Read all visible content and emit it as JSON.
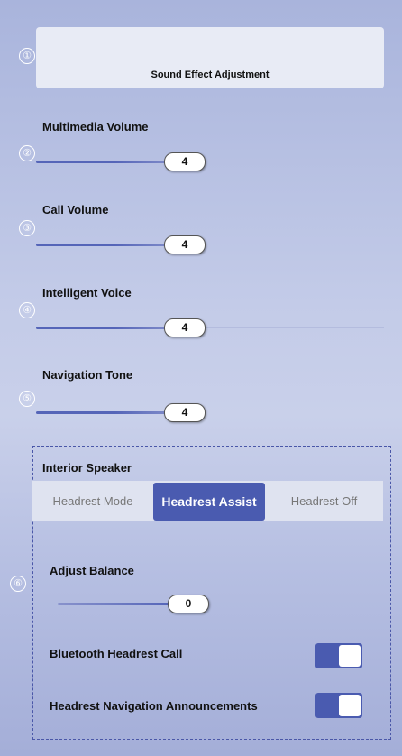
{
  "header": {
    "badge": "①",
    "title": "Sound Effect Adjustment"
  },
  "sliders": [
    {
      "badge": "②",
      "label": "Multimedia Volume",
      "value": "4"
    },
    {
      "badge": "③",
      "label": "Call Volume",
      "value": "4"
    },
    {
      "badge": "④",
      "label": "Intelligent Voice",
      "value": "4"
    },
    {
      "badge": "⑤",
      "label": "Navigation Tone",
      "value": "4"
    }
  ],
  "interior": {
    "badge": "⑥",
    "title": "Interior Speaker",
    "modes": [
      "Headrest Mode",
      "Headrest Assist",
      "Headrest Off"
    ],
    "selected_mode": "Headrest Assist",
    "balance_label": "Adjust Balance",
    "balance_value": "0",
    "bt_call_label": "Bluetooth Headrest Call",
    "nav_announce_label": "Headrest Navigation Announcements"
  },
  "colors": {
    "accent": "#4a5bb0"
  }
}
